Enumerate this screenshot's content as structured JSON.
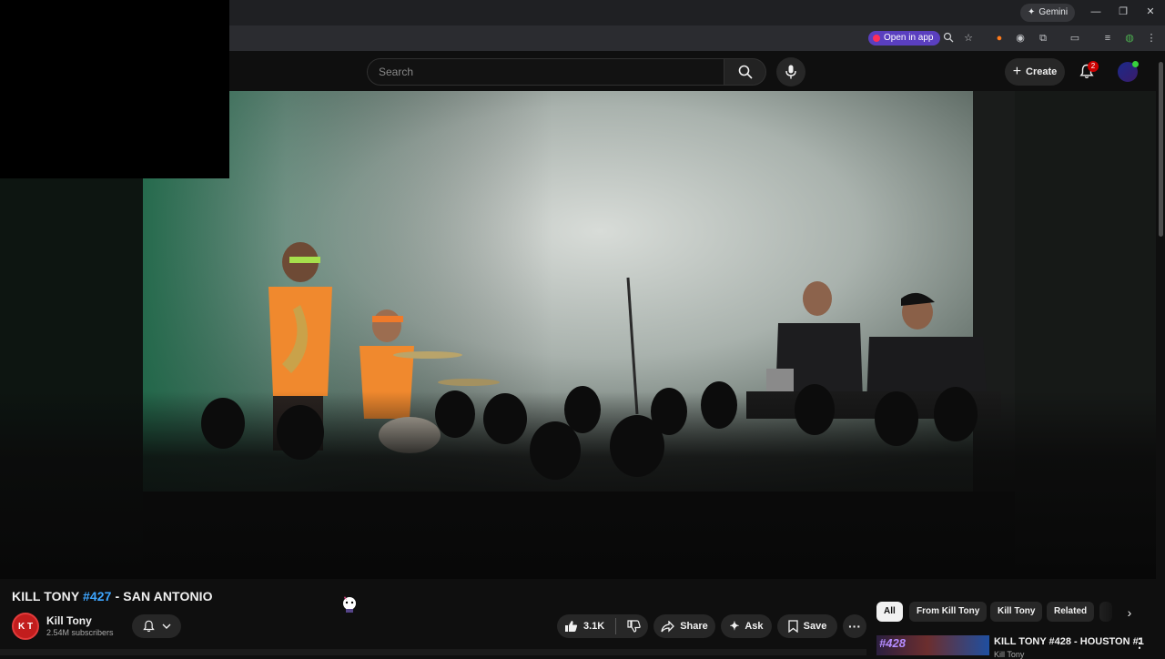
{
  "browser": {
    "gemini_label": "Gemini",
    "open_in_app_label": "Open in app",
    "window_controls": [
      "minimize-icon",
      "restore-icon",
      "close-icon"
    ],
    "extension_icons": [
      "zoom-icon",
      "star-icon",
      "extension-orange-icon",
      "extension-circle-icon",
      "puzzle-icon",
      "cast-icon",
      "playlist-icon",
      "profile-icon",
      "kebab-icon"
    ]
  },
  "header": {
    "search_placeholder": "Search",
    "create_label": "Create",
    "notification_count": "2"
  },
  "video": {
    "title_prefix": "KILL TONY ",
    "title_hashtag": "#427",
    "title_suffix": " - SAN ANTONIO",
    "channel": {
      "initials": "K T",
      "name": "Kill Tony",
      "subscribers": "2.54M subscribers"
    },
    "actions": {
      "like_count": "3.1K",
      "share_label": "Share",
      "ask_label": "Ask",
      "save_label": "Save"
    }
  },
  "chips": [
    {
      "label": "All",
      "active": true
    },
    {
      "label": "From Kill Tony",
      "active": false
    },
    {
      "label": "Kill Tony",
      "active": false
    },
    {
      "label": "Related",
      "active": false
    }
  ],
  "recommended": [
    {
      "thumb_text": "#428",
      "title": "KILL TONY #428 - HOUSTON #1",
      "channel": "Kill Tony"
    }
  ],
  "colors": {
    "accent_link": "#3ea6ff",
    "youtube_red": "#cc0000",
    "open_in_app": "#5a3fbf"
  }
}
